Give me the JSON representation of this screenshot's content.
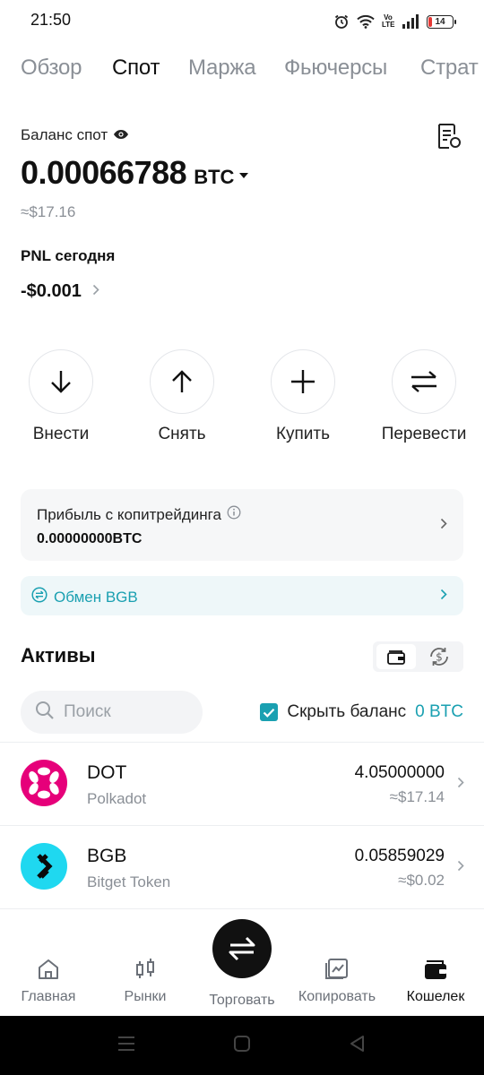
{
  "status_bar": {
    "time": "21:50",
    "battery_level": "14",
    "network_label": "Vo LTE"
  },
  "tabs": [
    {
      "label": "Обзор",
      "active": false
    },
    {
      "label": "Спот",
      "active": true
    },
    {
      "label": "Маржа",
      "active": false
    },
    {
      "label": "Фьючерсы",
      "active": false
    },
    {
      "label": "Страт",
      "active": false
    }
  ],
  "balance": {
    "label": "Баланс спот",
    "amount": "0.00066788",
    "currency": "BTC",
    "usd": "≈$17.16"
  },
  "pnl": {
    "label": "PNL сегодня",
    "value": "-$0.001"
  },
  "actions": [
    {
      "label": "Внести",
      "icon": "arrow-down-icon"
    },
    {
      "label": "Снять",
      "icon": "arrow-up-icon"
    },
    {
      "label": "Купить",
      "icon": "plus-icon"
    },
    {
      "label": "Перевести",
      "icon": "transfer-icon"
    }
  ],
  "copy_trading": {
    "title": "Прибыль с копитрейдинга",
    "value": "0.00000000BTC"
  },
  "exchange": {
    "label": "Обмен BGB"
  },
  "assets": {
    "title": "Активы",
    "search_placeholder": "Поиск",
    "hide_balance_label": "Скрыть баланс",
    "hide_balance_amount": "0 BTC",
    "hide_balance_checked": true,
    "items": [
      {
        "symbol": "DOT",
        "name": "Polkadot",
        "amount": "4.05000000",
        "usd": "≈$17.14",
        "color": "#e6007a"
      },
      {
        "symbol": "BGB",
        "name": "Bitget Token",
        "amount": "0.05859029",
        "usd": "≈$0.02",
        "color": "#1fd8f0"
      }
    ]
  },
  "bottom_nav": [
    {
      "label": "Главная",
      "icon": "home-icon",
      "active": false
    },
    {
      "label": "Рынки",
      "icon": "candles-icon",
      "active": false
    },
    {
      "label": "Торговать",
      "icon": "swap-icon",
      "active": false
    },
    {
      "label": "Копировать",
      "icon": "copy-chart-icon",
      "active": false
    },
    {
      "label": "Кошелек",
      "icon": "wallet-icon",
      "active": true
    }
  ],
  "colors": {
    "accent": "#1aa0b1",
    "text_secondary": "#8a8f96",
    "battery_low": "#e53935"
  }
}
